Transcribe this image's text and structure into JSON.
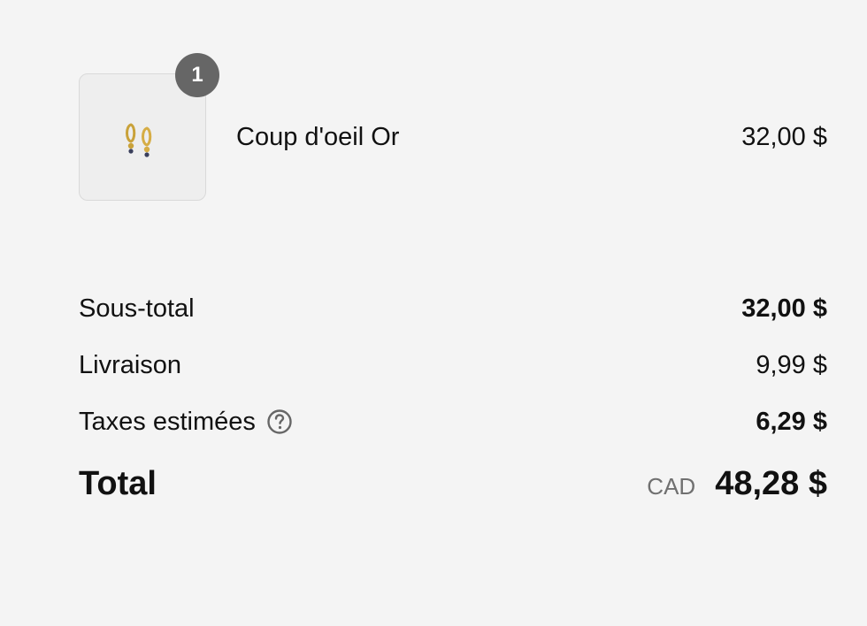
{
  "line_item": {
    "quantity": "1",
    "name": "Coup d'oeil Or",
    "price": "32,00 $",
    "image_icon": "gold-earrings-icon"
  },
  "summary": {
    "subtotal_label": "Sous-total",
    "subtotal_value": "32,00 $",
    "shipping_label": "Livraison",
    "shipping_value": "9,99 $",
    "taxes_label": "Taxes estimées",
    "taxes_value": "6,29 $",
    "taxes_help_icon": "question-circle-icon",
    "total_label": "Total",
    "currency": "CAD",
    "total_value": "48,28 $"
  },
  "colors": {
    "background": "#f4f4f4",
    "badge": "#666666",
    "text": "#111111",
    "muted": "#707070"
  }
}
